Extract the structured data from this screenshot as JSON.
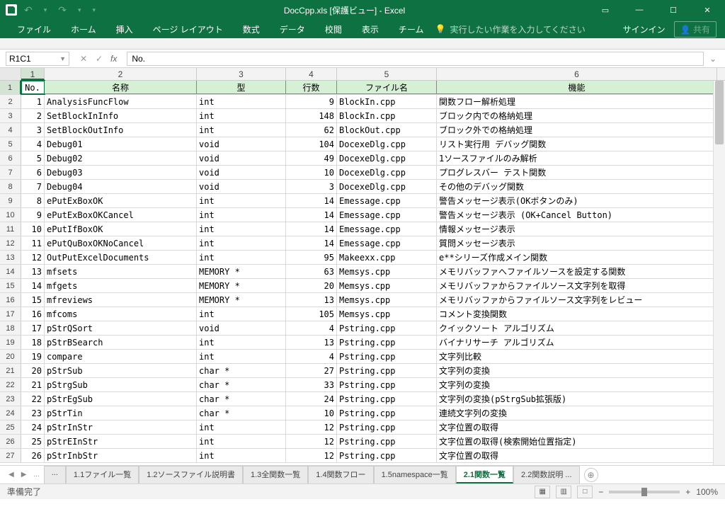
{
  "title": "DocCpp.xls [保護ビュー] - Excel",
  "qa": {
    "undo": "↶",
    "undo_dd": "▾",
    "redo": "↷",
    "redo_dd": "▾",
    "custom": "▾"
  },
  "win": {
    "ribbon": "▭",
    "min": "—",
    "max": "☐",
    "close": "✕"
  },
  "ribbon": [
    "ファイル",
    "ホーム",
    "挿入",
    "ページ レイアウト",
    "数式",
    "データ",
    "校閲",
    "表示",
    "チーム"
  ],
  "tell_me": "実行したい作業を入力してください",
  "signin": "サインイン",
  "share": "共有",
  "name_box": "R1C1",
  "formula": "No.",
  "fx": {
    "cancel": "✕",
    "enter": "✓",
    "fx": "fx"
  },
  "cols": [
    "1",
    "2",
    "3",
    "4",
    "5",
    "6"
  ],
  "headers": [
    "No.",
    "名称",
    "型",
    "行数",
    "ファイル名",
    "機能"
  ],
  "rows": [
    {
      "n": "1",
      "name": "AnalysisFuncFlow",
      "type": "int",
      "ln": "9",
      "file": "BlockIn.cpp",
      "fn": "関数フロー解析処理"
    },
    {
      "n": "2",
      "name": "SetBlockInInfo",
      "type": "int",
      "ln": "148",
      "file": "BlockIn.cpp",
      "fn": "ブロック内での格納処理"
    },
    {
      "n": "3",
      "name": "SetBlockOutInfo",
      "type": "int",
      "ln": "62",
      "file": "BlockOut.cpp",
      "fn": "ブロック外での格納処理"
    },
    {
      "n": "4",
      "name": "Debug01",
      "type": "void",
      "ln": "104",
      "file": "DocexeDlg.cpp",
      "fn": "リスト実行用 デバッグ関数"
    },
    {
      "n": "5",
      "name": "Debug02",
      "type": "void",
      "ln": "49",
      "file": "DocexeDlg.cpp",
      "fn": "1ソースファイルのみ解析"
    },
    {
      "n": "6",
      "name": "Debug03",
      "type": "void",
      "ln": "10",
      "file": "DocexeDlg.cpp",
      "fn": "プログレスバー テスト関数"
    },
    {
      "n": "7",
      "name": "Debug04",
      "type": "void",
      "ln": "3",
      "file": "DocexeDlg.cpp",
      "fn": "その他のデバッグ関数"
    },
    {
      "n": "8",
      "name": "ePutExBoxOK",
      "type": "int",
      "ln": "14",
      "file": "Emessage.cpp",
      "fn": "警告メッセージ表示(OKボタンのみ)"
    },
    {
      "n": "9",
      "name": "ePutExBoxOKCancel",
      "type": "int",
      "ln": "14",
      "file": "Emessage.cpp",
      "fn": "警告メッセージ表示 (OK+Cancel Button)"
    },
    {
      "n": "10",
      "name": "ePutIfBoxOK",
      "type": "int",
      "ln": "14",
      "file": "Emessage.cpp",
      "fn": "情報メッセージ表示"
    },
    {
      "n": "11",
      "name": "ePutQuBoxOKNoCancel",
      "type": "int",
      "ln": "14",
      "file": "Emessage.cpp",
      "fn": "質問メッセージ表示"
    },
    {
      "n": "12",
      "name": "OutPutExcelDocuments",
      "type": "int",
      "ln": "95",
      "file": "Makeexx.cpp",
      "fn": "e**シリーズ作成メイン関数"
    },
    {
      "n": "13",
      "name": "mfsets",
      "type": "MEMORY *",
      "ln": "63",
      "file": "Memsys.cpp",
      "fn": "メモリバッファへファイルソースを設定する関数"
    },
    {
      "n": "14",
      "name": "mfgets",
      "type": "MEMORY *",
      "ln": "20",
      "file": "Memsys.cpp",
      "fn": "メモリバッファからファイルソース文字列を取得"
    },
    {
      "n": "15",
      "name": "mfreviews",
      "type": "MEMORY *",
      "ln": "13",
      "file": "Memsys.cpp",
      "fn": "メモリバッファからファイルソース文字列をレビュー"
    },
    {
      "n": "16",
      "name": "mfcoms",
      "type": "int",
      "ln": "105",
      "file": "Memsys.cpp",
      "fn": "コメント変換関数"
    },
    {
      "n": "17",
      "name": "pStrQSort",
      "type": "void",
      "ln": "4",
      "file": "Pstring.cpp",
      "fn": "クイックソート アルゴリズム"
    },
    {
      "n": "18",
      "name": "pStrBSearch",
      "type": "int",
      "ln": "13",
      "file": "Pstring.cpp",
      "fn": "バイナリサーチ アルゴリズム"
    },
    {
      "n": "19",
      "name": "compare",
      "type": "int",
      "ln": "4",
      "file": "Pstring.cpp",
      "fn": "文字列比較"
    },
    {
      "n": "20",
      "name": "pStrSub",
      "type": "char *",
      "ln": "27",
      "file": "Pstring.cpp",
      "fn": "文字列の変換"
    },
    {
      "n": "21",
      "name": "pStrgSub",
      "type": "char *",
      "ln": "33",
      "file": "Pstring.cpp",
      "fn": "文字列の変換"
    },
    {
      "n": "22",
      "name": "pStrEgSub",
      "type": "char *",
      "ln": "24",
      "file": "Pstring.cpp",
      "fn": "文字列の変換(pStrgSub拡張版)"
    },
    {
      "n": "23",
      "name": "pStrTin",
      "type": "char *",
      "ln": "10",
      "file": "Pstring.cpp",
      "fn": "連続文字列の変換"
    },
    {
      "n": "24",
      "name": "pStrInStr",
      "type": "int",
      "ln": "12",
      "file": "Pstring.cpp",
      "fn": "文字位置の取得"
    },
    {
      "n": "25",
      "name": "pStrEInStr",
      "type": "int",
      "ln": "12",
      "file": "Pstring.cpp",
      "fn": "文字位置の取得(検索開始位置指定)"
    },
    {
      "n": "26",
      "name": "pStrInbStr",
      "type": "int",
      "ln": "12",
      "file": "Pstring.cpp",
      "fn": "文字位置の取得"
    }
  ],
  "tabs": [
    "...",
    "1.1ファイル一覧",
    "1.2ソースファイル説明書",
    "1.3全関数一覧",
    "1.4関数フロー",
    "1.5namespace一覧",
    "2.1関数一覧",
    "2.2関数説明 ..."
  ],
  "active_tab": 6,
  "status": "準備完了",
  "zoom": "100%",
  "views": {
    "normal": "▦",
    "layout": "▥",
    "break": "□"
  },
  "zoom_ctrl": {
    "minus": "−",
    "plus": "+"
  },
  "nav": {
    "prev": "◀",
    "next": "▶",
    "more": "..."
  },
  "add": "⊕"
}
